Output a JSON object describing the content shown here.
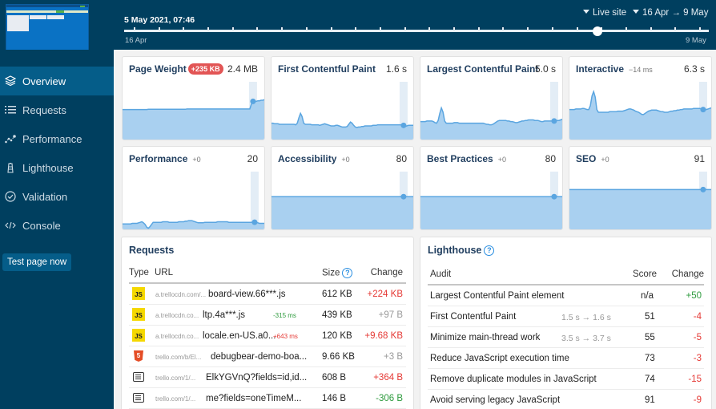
{
  "header": {
    "selected_date": "5 May 2021, 07:46",
    "environment_label": "Live site",
    "date_range_label": "16 Apr → 9 May",
    "slider": {
      "start_label": "16 Apr",
      "end_label": "9 May",
      "selected_position_fraction": 0.81,
      "tick_count": 24
    }
  },
  "sidebar": {
    "items": [
      {
        "label": "Overview",
        "icon": "layers-icon",
        "active": true
      },
      {
        "label": "Requests",
        "icon": "list-icon",
        "active": false
      },
      {
        "label": "Performance",
        "icon": "scatter-chart-icon",
        "active": false
      },
      {
        "label": "Lighthouse",
        "icon": "lighthouse-icon",
        "active": false
      },
      {
        "label": "Validation",
        "icon": "check-circle-icon",
        "active": false
      },
      {
        "label": "Console",
        "icon": "code-icon",
        "active": false
      }
    ],
    "test_button": "Test page now"
  },
  "metrics": [
    {
      "title": "Page Weight",
      "badge": "+235 KB",
      "delta": "",
      "value": "2.4 MB",
      "series": [
        0.55,
        0.55,
        0.55,
        0.55,
        0.55,
        0.55,
        0.55,
        0.55,
        0.55,
        0.55,
        0.55,
        0.55,
        0.55,
        0.55,
        0.55,
        0.55,
        0.555,
        0.555,
        0.555,
        0.555,
        0.555,
        0.555,
        0.555,
        0.555,
        0.555,
        0.555,
        0.555,
        0.555,
        0.555,
        0.555,
        0.555,
        0.555,
        0.555,
        0.555,
        0.555,
        0.555,
        0.555,
        0.555,
        0.555,
        0.555,
        0.56,
        0.56,
        0.56,
        0.56,
        0.56,
        0.56,
        0.56,
        0.56,
        0.56,
        0.56,
        0.56,
        0.56,
        0.56,
        0.56,
        0.56,
        0.56,
        0.56,
        0.56,
        0.56,
        0.56,
        0.56,
        0.56,
        0.56,
        0.56,
        0.56,
        0.56,
        0.56,
        0.56,
        0.56,
        0.56,
        0.56,
        0.56,
        0.56,
        0.56,
        0.56,
        0.56,
        0.56,
        0.56,
        0.56,
        0.56,
        0.65,
        0.7,
        0.7,
        0.7,
        0.71,
        0.71,
        0.72,
        0.72,
        0.73,
        0.73
      ],
      "marker_index": 81
    },
    {
      "title": "First Contentful Paint",
      "badge": "",
      "delta": "",
      "value": "1.6 s",
      "series": [
        0.3,
        0.3,
        0.29,
        0.29,
        0.29,
        0.28,
        0.28,
        0.28,
        0.28,
        0.28,
        0.28,
        0.28,
        0.28,
        0.28,
        0.28,
        0.27,
        0.3,
        0.4,
        0.48,
        0.42,
        0.3,
        0.28,
        0.28,
        0.28,
        0.28,
        0.27,
        0.27,
        0.27,
        0.27,
        0.27,
        0.26,
        0.27,
        0.28,
        0.29,
        0.28,
        0.27,
        0.26,
        0.25,
        0.25,
        0.25,
        0.26,
        0.26,
        0.25,
        0.24,
        0.23,
        0.23,
        0.23,
        0.24,
        0.28,
        0.32,
        0.3,
        0.26,
        0.23,
        0.22,
        0.23,
        0.23,
        0.24,
        0.24,
        0.25,
        0.25,
        0.25,
        0.25,
        0.25,
        0.26,
        0.26,
        0.26,
        0.27,
        0.27,
        0.27,
        0.27,
        0.27,
        0.27,
        0.27,
        0.27,
        0.27,
        0.27,
        0.27,
        0.27,
        0.27,
        0.27,
        0.27,
        0.27,
        0.26,
        0.24,
        0.25,
        0.26,
        0.26,
        0.26,
        0.26,
        0.26
      ],
      "marker_index": 82
    },
    {
      "title": "Largest Contentful Paint",
      "badge": "",
      "delta": "",
      "value": "5.0 s",
      "series": [
        0.33,
        0.33,
        0.33,
        0.33,
        0.34,
        0.34,
        0.34,
        0.34,
        0.33,
        0.31,
        0.3,
        0.35,
        0.48,
        0.58,
        0.5,
        0.34,
        0.3,
        0.3,
        0.3,
        0.3,
        0.3,
        0.31,
        0.31,
        0.31,
        0.3,
        0.3,
        0.3,
        0.3,
        0.3,
        0.3,
        0.3,
        0.3,
        0.3,
        0.3,
        0.3,
        0.3,
        0.3,
        0.3,
        0.3,
        0.3,
        0.29,
        0.28,
        0.28,
        0.27,
        0.27,
        0.28,
        0.3,
        0.32,
        0.34,
        0.35,
        0.35,
        0.35,
        0.35,
        0.35,
        0.34,
        0.34,
        0.33,
        0.33,
        0.32,
        0.31,
        0.31,
        0.32,
        0.33,
        0.34,
        0.34,
        0.35,
        0.35,
        0.36,
        0.36,
        0.36,
        0.36,
        0.35,
        0.35,
        0.35,
        0.34,
        0.33,
        0.33,
        0.34,
        0.34,
        0.34,
        0.34,
        0.34,
        0.34,
        0.34,
        0.34,
        0.35,
        0.35,
        0.36,
        0.37,
        0.37
      ],
      "marker_index": 83
    },
    {
      "title": "Interactive",
      "badge": "",
      "delta": "−14 ms",
      "value": "6.3 s",
      "series": [
        0.55,
        0.55,
        0.55,
        0.55,
        0.56,
        0.56,
        0.56,
        0.56,
        0.57,
        0.57,
        0.56,
        0.55,
        0.55,
        0.62,
        0.8,
        0.88,
        0.78,
        0.55,
        0.5,
        0.5,
        0.5,
        0.5,
        0.5,
        0.5,
        0.5,
        0.51,
        0.51,
        0.51,
        0.51,
        0.51,
        0.52,
        0.52,
        0.52,
        0.52,
        0.53,
        0.54,
        0.55,
        0.56,
        0.56,
        0.55,
        0.54,
        0.52,
        0.51,
        0.5,
        0.48,
        0.46,
        0.46,
        0.48,
        0.5,
        0.52,
        0.53,
        0.54,
        0.54,
        0.54,
        0.54,
        0.53,
        0.52,
        0.51,
        0.51,
        0.5,
        0.5,
        0.5,
        0.51,
        0.52,
        0.52,
        0.53,
        0.53,
        0.54,
        0.54,
        0.55,
        0.55,
        0.56,
        0.56,
        0.56,
        0.56,
        0.56,
        0.56,
        0.57,
        0.57,
        0.57,
        0.57,
        0.57,
        0.56,
        0.55,
        0.55,
        0.55,
        0.56,
        0.57,
        0.58,
        0.58
      ],
      "marker_index": 83
    },
    {
      "title": "Performance",
      "badge": "",
      "delta": "+0",
      "value": "20",
      "series": [
        0.1,
        0.1,
        0.1,
        0.1,
        0.1,
        0.1,
        0.11,
        0.11,
        0.11,
        0.11,
        0.12,
        0.13,
        0.14,
        0.12,
        0.09,
        0.04,
        0.02,
        0.05,
        0.09,
        0.13,
        0.13,
        0.13,
        0.13,
        0.13,
        0.13,
        0.14,
        0.14,
        0.14,
        0.14,
        0.13,
        0.13,
        0.13,
        0.13,
        0.13,
        0.13,
        0.14,
        0.14,
        0.14,
        0.14,
        0.15,
        0.15,
        0.16,
        0.16,
        0.16,
        0.15,
        0.14,
        0.13,
        0.12,
        0.12,
        0.12,
        0.12,
        0.13,
        0.13,
        0.13,
        0.13,
        0.13,
        0.13,
        0.13,
        0.13,
        0.14,
        0.14,
        0.14,
        0.14,
        0.14,
        0.14,
        0.14,
        0.13,
        0.13,
        0.13,
        0.13,
        0.13,
        0.13,
        0.13,
        0.13,
        0.13,
        0.13,
        0.13,
        0.13,
        0.13,
        0.13,
        0.13,
        0.13,
        0.13,
        0.13,
        0.12,
        0.11,
        0.11,
        0.11,
        0.11,
        0.11
      ],
      "marker_index": 82
    },
    {
      "title": "Accessibility",
      "badge": "",
      "delta": "+0",
      "value": "80",
      "series": [
        0.6,
        0.6,
        0.6,
        0.6,
        0.6,
        0.6,
        0.6,
        0.6,
        0.6,
        0.6,
        0.6,
        0.6,
        0.6,
        0.6,
        0.6,
        0.6,
        0.6,
        0.6,
        0.6,
        0.6,
        0.6,
        0.6,
        0.6,
        0.6,
        0.6,
        0.6,
        0.6,
        0.6,
        0.6,
        0.6,
        0.6,
        0.6,
        0.6,
        0.6,
        0.6,
        0.6,
        0.6,
        0.6,
        0.6,
        0.6,
        0.6,
        0.6,
        0.6,
        0.6,
        0.6,
        0.6,
        0.6,
        0.6,
        0.6,
        0.6,
        0.6,
        0.6,
        0.6,
        0.6,
        0.6,
        0.6,
        0.6,
        0.6,
        0.6,
        0.6,
        0.6,
        0.6,
        0.6,
        0.6,
        0.6,
        0.6,
        0.6,
        0.6,
        0.6,
        0.6,
        0.6,
        0.6,
        0.6,
        0.6,
        0.6,
        0.6,
        0.6,
        0.6,
        0.6,
        0.6,
        0.6,
        0.6,
        0.6,
        0.6,
        0.6,
        0.6,
        0.6,
        0.6,
        0.6,
        0.6
      ],
      "marker_index": 82
    },
    {
      "title": "Best Practices",
      "badge": "",
      "delta": "+0",
      "value": "80",
      "series": [
        0.6,
        0.6,
        0.6,
        0.6,
        0.6,
        0.6,
        0.6,
        0.6,
        0.6,
        0.6,
        0.6,
        0.6,
        0.6,
        0.6,
        0.6,
        0.6,
        0.6,
        0.6,
        0.6,
        0.6,
        0.6,
        0.6,
        0.6,
        0.6,
        0.6,
        0.6,
        0.6,
        0.6,
        0.6,
        0.6,
        0.6,
        0.6,
        0.6,
        0.6,
        0.6,
        0.6,
        0.6,
        0.6,
        0.6,
        0.6,
        0.6,
        0.6,
        0.6,
        0.6,
        0.6,
        0.6,
        0.6,
        0.6,
        0.6,
        0.6,
        0.6,
        0.6,
        0.6,
        0.6,
        0.6,
        0.6,
        0.6,
        0.6,
        0.6,
        0.6,
        0.6,
        0.6,
        0.6,
        0.6,
        0.6,
        0.6,
        0.6,
        0.6,
        0.6,
        0.6,
        0.6,
        0.6,
        0.6,
        0.6,
        0.6,
        0.6,
        0.6,
        0.6,
        0.6,
        0.6,
        0.6,
        0.6,
        0.6,
        0.6,
        0.6,
        0.6,
        0.6,
        0.6,
        0.6,
        0.6
      ],
      "marker_index": 83
    },
    {
      "title": "SEO",
      "badge": "",
      "delta": "+0",
      "value": "91",
      "series": [
        0.73,
        0.73,
        0.73,
        0.73,
        0.73,
        0.73,
        0.73,
        0.73,
        0.73,
        0.73,
        0.73,
        0.73,
        0.73,
        0.73,
        0.73,
        0.73,
        0.73,
        0.73,
        0.73,
        0.73,
        0.73,
        0.73,
        0.73,
        0.73,
        0.73,
        0.73,
        0.73,
        0.73,
        0.73,
        0.73,
        0.73,
        0.73,
        0.73,
        0.73,
        0.73,
        0.73,
        0.73,
        0.73,
        0.73,
        0.73,
        0.73,
        0.73,
        0.73,
        0.73,
        0.73,
        0.73,
        0.73,
        0.73,
        0.73,
        0.73,
        0.73,
        0.73,
        0.73,
        0.73,
        0.73,
        0.73,
        0.73,
        0.73,
        0.73,
        0.73,
        0.73,
        0.73,
        0.73,
        0.73,
        0.73,
        0.73,
        0.73,
        0.73,
        0.73,
        0.73,
        0.73,
        0.73,
        0.73,
        0.73,
        0.73,
        0.73,
        0.73,
        0.73,
        0.73,
        0.73,
        0.73,
        0.73,
        0.73,
        0.73,
        0.73,
        0.73,
        0.73,
        0.73,
        0.73,
        0.73
      ],
      "marker_index": 83
    }
  ],
  "requests": {
    "title": "Requests",
    "columns": {
      "type": "Type",
      "url": "URL",
      "size": "Size",
      "change": "Change"
    },
    "rows": [
      {
        "type": "JS",
        "host": "a.trellocdn.com/...",
        "name": "board-view.66***.js",
        "timing": "",
        "timing_color": "",
        "size": "612 KB",
        "change": "+224 KB",
        "change_color": "red"
      },
      {
        "type": "JS",
        "host": "a.trellocdn.co...",
        "name": "ltp.4a***.js",
        "timing": "-315 ms",
        "timing_color": "green",
        "size": "439 KB",
        "change": "+97 B",
        "change_color": "grey"
      },
      {
        "type": "JS",
        "host": "a.trellocdn.co...",
        "name": "locale.en-US.a0...",
        "timing": "+643 ms",
        "timing_color": "red",
        "size": "120 KB",
        "change": "+9.68 KB",
        "change_color": "red"
      },
      {
        "type": "HTML",
        "host": "trello.com/b/El...",
        "name": "debugbear-demo-boa...",
        "timing": "",
        "timing_color": "",
        "size": "9.66 KB",
        "change": "+3 B",
        "change_color": "grey"
      },
      {
        "type": "Document",
        "host": "trello.com/1/...",
        "name": "ElkYGVnQ?fields=id,id...",
        "timing": "",
        "timing_color": "",
        "size": "608 B",
        "change": "+364 B",
        "change_color": "red"
      },
      {
        "type": "Document",
        "host": "trello.com/1/...",
        "name": "me?fields=oneTimeM...",
        "timing": "",
        "timing_color": "",
        "size": "146 B",
        "change": "-306 B",
        "change_color": "green"
      }
    ]
  },
  "lighthouse": {
    "title": "Lighthouse",
    "columns": {
      "audit": "Audit",
      "score": "Score",
      "change": "Change"
    },
    "rows": [
      {
        "audit": "Largest Contentful Paint element",
        "detail": "",
        "score": "n/a",
        "change": "+50",
        "change_color": "green"
      },
      {
        "audit": "First Contentful Paint",
        "detail": "1.5 s → 1.6 s",
        "score": "51",
        "change": "-4",
        "change_color": "red"
      },
      {
        "audit": "Minimize main-thread work",
        "detail": "3.5 s → 3.7 s",
        "score": "55",
        "change": "-5",
        "change_color": "red"
      },
      {
        "audit": "Reduce JavaScript execution time",
        "detail": "",
        "score": "73",
        "change": "-3",
        "change_color": "red"
      },
      {
        "audit": "Remove duplicate modules in JavaScript",
        "detail": "",
        "score": "74",
        "change": "-15",
        "change_color": "red"
      },
      {
        "audit": "Avoid serving legacy JavaScript",
        "detail": "",
        "score": "91",
        "change": "-9",
        "change_color": "red"
      }
    ]
  },
  "colors": {
    "nav_bg": "#003f5f",
    "nav_active": "#055d89",
    "chart_fill": "#a9d0f0",
    "chart_line": "#5aa5e0",
    "red": "#e53935",
    "green": "#2e9b3e"
  }
}
